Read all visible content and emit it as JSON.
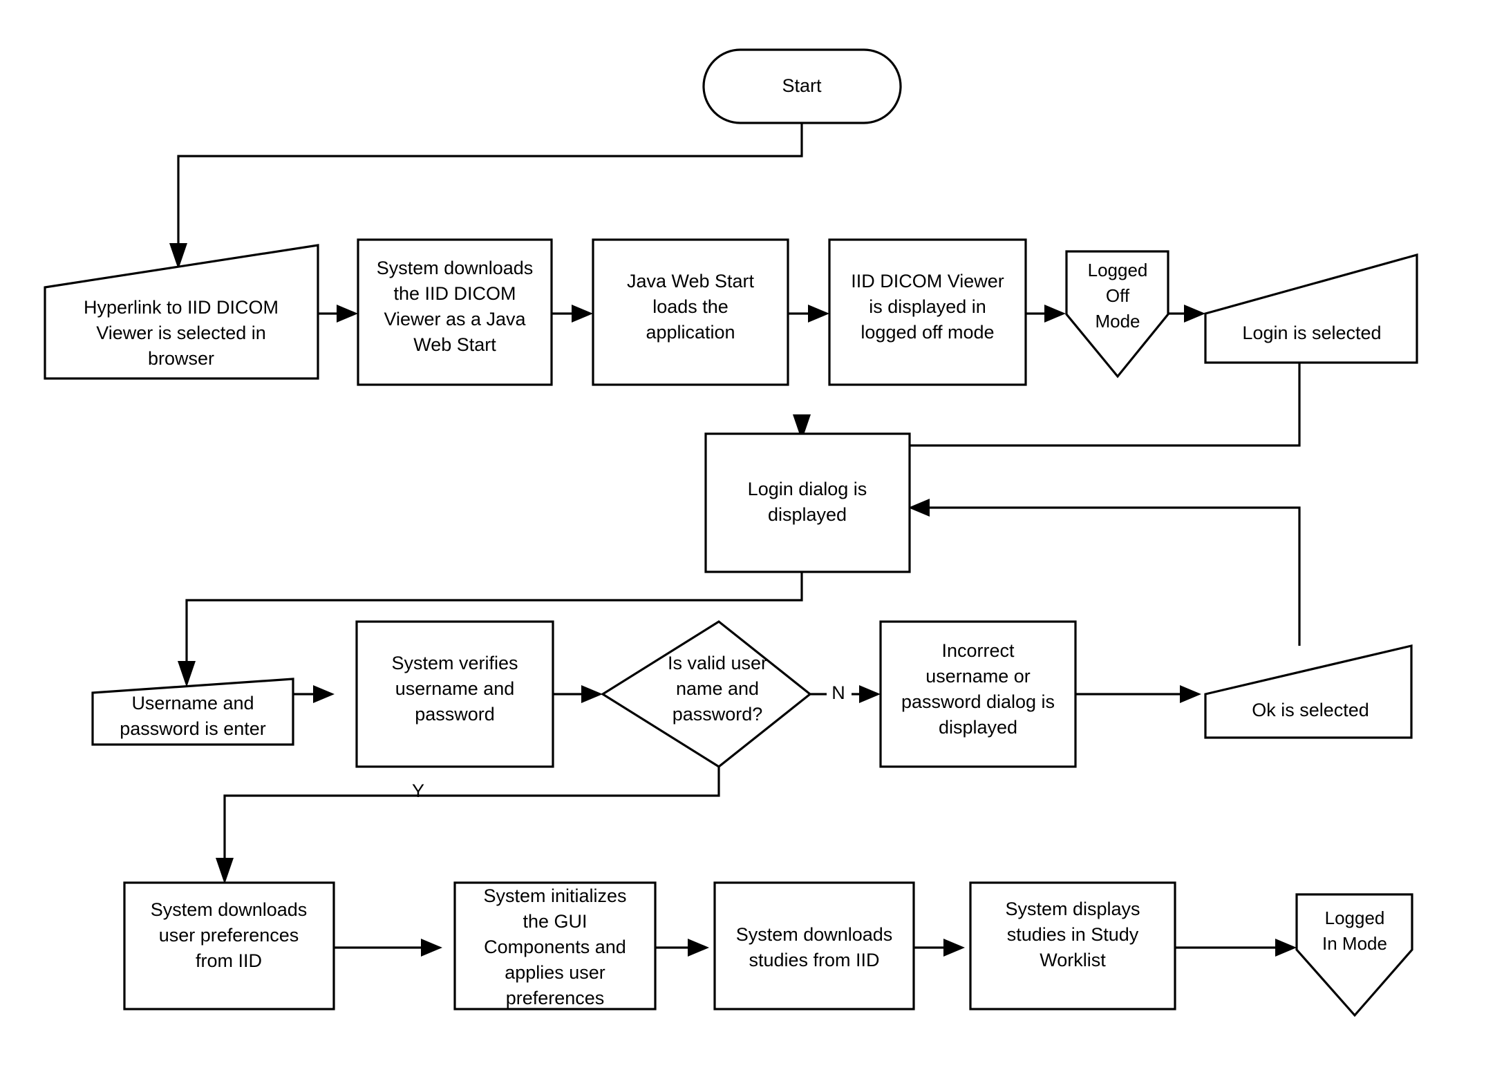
{
  "diagram": {
    "type": "flowchart",
    "title": "IID DICOM Viewer login flow",
    "nodes": [
      {
        "id": "start",
        "label": "Start",
        "shape": "terminator"
      },
      {
        "id": "hyperlink",
        "label": "Hyperlink to IID DICOM Viewer is selected in browser",
        "shape": "manual-input"
      },
      {
        "id": "download",
        "label": "System downloads the IID DICOM Viewer as a Java Web Start",
        "shape": "process"
      },
      {
        "id": "jws",
        "label": "Java Web Start loads the application",
        "shape": "process"
      },
      {
        "id": "loggedoffview",
        "label": "IID DICOM Viewer is displayed in logged off mode",
        "shape": "process"
      },
      {
        "id": "loggedoffmode",
        "label": "Logged Off Mode",
        "shape": "pentagon-down"
      },
      {
        "id": "loginsel",
        "label": "Login is selected",
        "shape": "manual-input"
      },
      {
        "id": "logindialog",
        "label": "Login dialog is displayed",
        "shape": "process"
      },
      {
        "id": "userpass",
        "label": "Username and password is enter",
        "shape": "manual-input"
      },
      {
        "id": "verify",
        "label": "System verifies username and password",
        "shape": "process"
      },
      {
        "id": "decision",
        "label": "Is valid user name and password?",
        "shape": "decision"
      },
      {
        "id": "incorrect",
        "label": "Incorrect username or password dialog is displayed",
        "shape": "process"
      },
      {
        "id": "oksel",
        "label": "Ok is selected",
        "shape": "manual-input"
      },
      {
        "id": "prefs",
        "label": "System downloads user preferences from IID",
        "shape": "process"
      },
      {
        "id": "initgui",
        "label": "System initializes the GUI Components and applies user preferences",
        "shape": "process"
      },
      {
        "id": "dlstudies",
        "label": "System downloads studies from IID",
        "shape": "process"
      },
      {
        "id": "dispstudies",
        "label": "System displays studies in Study Worklist",
        "shape": "process"
      },
      {
        "id": "loggedinmode",
        "label": "Logged In Mode",
        "shape": "pentagon-down"
      }
    ],
    "edges": [
      {
        "from": "start",
        "to": "hyperlink",
        "label": ""
      },
      {
        "from": "hyperlink",
        "to": "download",
        "label": ""
      },
      {
        "from": "download",
        "to": "jws",
        "label": ""
      },
      {
        "from": "jws",
        "to": "loggedoffview",
        "label": ""
      },
      {
        "from": "loggedoffview",
        "to": "loggedoffmode",
        "label": ""
      },
      {
        "from": "loggedoffmode",
        "to": "loginsel",
        "label": ""
      },
      {
        "from": "loginsel",
        "to": "logindialog",
        "label": ""
      },
      {
        "from": "logindialog",
        "to": "userpass",
        "label": ""
      },
      {
        "from": "userpass",
        "to": "verify",
        "label": ""
      },
      {
        "from": "verify",
        "to": "decision",
        "label": ""
      },
      {
        "from": "decision",
        "to": "incorrect",
        "label": "N"
      },
      {
        "from": "incorrect",
        "to": "oksel",
        "label": ""
      },
      {
        "from": "oksel",
        "to": "logindialog",
        "label": ""
      },
      {
        "from": "decision",
        "to": "prefs",
        "label": "Y"
      },
      {
        "from": "prefs",
        "to": "initgui",
        "label": ""
      },
      {
        "from": "initgui",
        "to": "dlstudies",
        "label": ""
      },
      {
        "from": "dlstudies",
        "to": "dispstudies",
        "label": ""
      },
      {
        "from": "dispstudies",
        "to": "loggedinmode",
        "label": ""
      }
    ],
    "edge_labels": {
      "no": "N",
      "yes": "Y"
    },
    "node_lines": {
      "start": [
        "Start"
      ],
      "hyperlink": [
        "Hyperlink to IID DICOM",
        "Viewer is selected in",
        "browser"
      ],
      "download": [
        "System downloads",
        "the IID DICOM",
        "Viewer as a Java",
        "Web Start"
      ],
      "jws": [
        "Java Web Start",
        "loads the",
        "application"
      ],
      "loggedoffview": [
        "IID DICOM Viewer",
        "is displayed in",
        "logged off mode"
      ],
      "loggedoffmode": [
        "Logged",
        "Off",
        "Mode"
      ],
      "loginsel": [
        "Login is selected"
      ],
      "logindialog": [
        "Login dialog is",
        "displayed"
      ],
      "userpass": [
        "Username and",
        "password is enter"
      ],
      "verify": [
        "System verifies",
        "username and",
        "password"
      ],
      "decision": [
        "Is valid user",
        "name and",
        "password?"
      ],
      "incorrect": [
        "Incorrect",
        "username or",
        "password dialog is",
        "displayed"
      ],
      "oksel": [
        "Ok is selected"
      ],
      "prefs": [
        "System downloads",
        "user preferences",
        "from IID"
      ],
      "initgui": [
        "System initializes",
        "the GUI",
        "Components and",
        "applies user",
        "preferences"
      ],
      "dlstudies": [
        "System downloads",
        "studies from IID"
      ],
      "dispstudies": [
        "System displays",
        "studies in Study",
        "Worklist"
      ],
      "loggedinmode": [
        "Logged",
        "In Mode"
      ]
    },
    "colors": {
      "stroke": "#000000",
      "fill": "#ffffff",
      "text": "#000000",
      "background": "#ffffff"
    }
  }
}
